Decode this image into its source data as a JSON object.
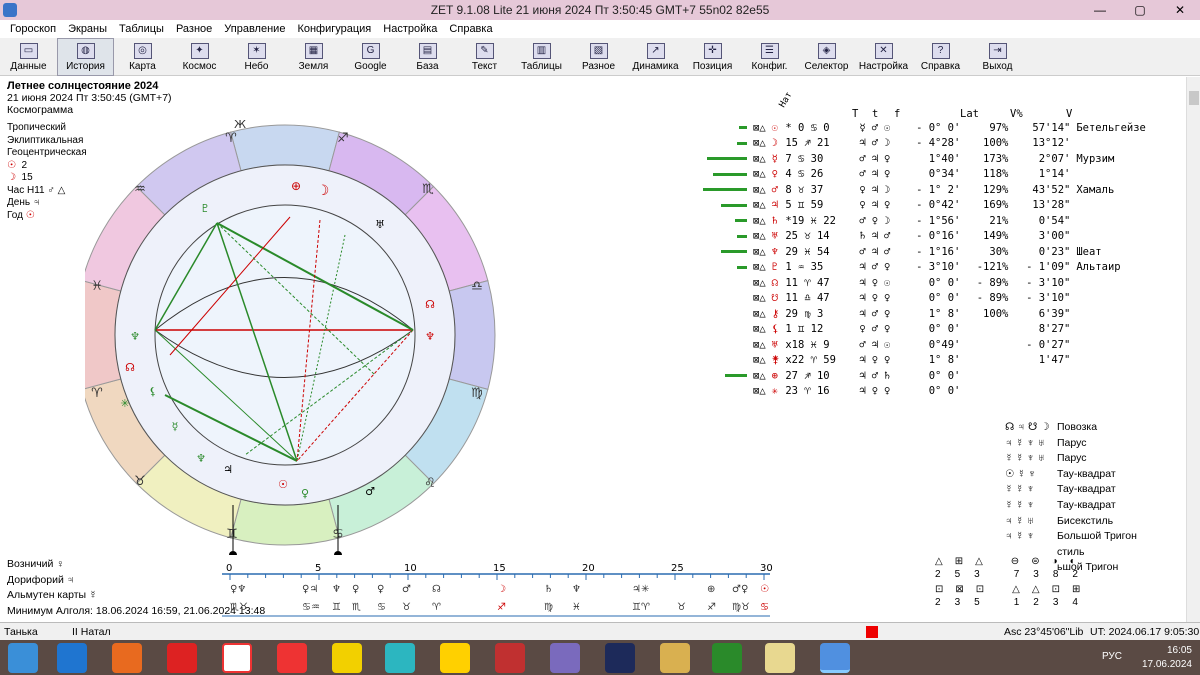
{
  "window": {
    "title": "ZET 9.1.08 Lite    21 июня 2024  Пт    3:50:45 GMT+7 55n02  82e55"
  },
  "menu": [
    "Гороскоп",
    "Экраны",
    "Таблицы",
    "Разное",
    "Управление",
    "Конфигурация",
    "Настройка",
    "Справка"
  ],
  "toolbar": [
    "Данные",
    "История",
    "Карта",
    "Космос",
    "Небо",
    "Земля",
    "Google",
    "База",
    "Текст",
    "Таблицы",
    "Разное",
    "Динамика",
    "Позиция",
    "Конфиг.",
    "Селектор",
    "Настройка",
    "Справка",
    "Выход"
  ],
  "header": {
    "title": "Летнее солнцестояние 2024",
    "date": "21 июня 2024  Пт   3:50:45 (GMT+7)",
    "type": "Космограмма",
    "zodiac": "Тропический",
    "coords": "Эклиптикальная",
    "center": "Геоцентрическая",
    "sun": "2",
    "moon": "15",
    "hour": "Час Н11",
    "day": "День",
    "year": "Год"
  },
  "chart_labels": {
    "natal_col": "Нат",
    "col_T": "T",
    "col_t": "t",
    "col_f": "f",
    "col_lat": "Lat",
    "col_vpct": "V%",
    "col_v": "V"
  },
  "aspect_rows": [
    {
      "sym": "☉",
      "pos": "* 0 ♋ 0",
      "T": "☿",
      "t": "♂",
      "f": "☉",
      "lat": "- 0° 0'",
      "vp": "97%",
      "v": "57'14\"",
      "star": "Бетельгейзе",
      "bar": "#2a9a2a",
      "bw": 8
    },
    {
      "sym": "☽",
      "pos": "15 ♐ 21",
      "T": "♃",
      "t": "♂",
      "f": "☽",
      "lat": "- 4°28'",
      "vp": "100%",
      "v": "13°12'",
      "star": "",
      "bar": "#2a9a2a",
      "bw": 10
    },
    {
      "sym": "☿",
      "pos": "7 ♋ 30",
      "T": "♂",
      "t": "♃",
      "f": "♀",
      "lat": "1°40'",
      "vp": "173%",
      "v": "2°07'",
      "star": "Мурзим",
      "bar": "#2a9a2a",
      "bw": 40
    },
    {
      "sym": "♀",
      "pos": "4 ♋ 26",
      "T": "♂",
      "t": "♃",
      "f": "♀",
      "lat": "0°34'",
      "vp": "118%",
      "v": "1°14'",
      "star": "",
      "bar": "#2a9a2a",
      "bw": 34
    },
    {
      "sym": "♂",
      "pos": "8 ♉ 37",
      "T": "♀",
      "t": "♃",
      "f": "☽",
      "lat": "- 1° 2'",
      "vp": "129%",
      "v": "43'52\"",
      "star": "Хамаль",
      "bar": "#2a9a2a",
      "bw": 44
    },
    {
      "sym": "♃",
      "pos": "5 ♊ 59",
      "T": "♀",
      "t": "♃",
      "f": "♀",
      "lat": "- 0°42'",
      "vp": "169%",
      "v": "13'28\"",
      "star": "",
      "bar": "#2a9a2a",
      "bw": 26
    },
    {
      "sym": "♄",
      "pos": "*19 ♓ 22",
      "T": "♂",
      "t": "♀",
      "f": "☽",
      "lat": "- 1°56'",
      "vp": "21%",
      "v": "0'54\"",
      "star": "",
      "bar": "#2a9a2a",
      "bw": 12
    },
    {
      "sym": "♅",
      "pos": "25 ♉ 14",
      "T": "♄",
      "t": "♃",
      "f": "♂",
      "lat": "- 0°16'",
      "vp": "149%",
      "v": "3'00\"",
      "star": "",
      "bar": "#2a9a2a",
      "bw": 10
    },
    {
      "sym": "♆",
      "pos": "29 ♓ 54",
      "T": "♂",
      "t": "♃",
      "f": "♂",
      "lat": "- 1°16'",
      "vp": "30%",
      "v": "0'23\"",
      "star": "Шеат",
      "bar": "#2a9a2a",
      "bw": 26
    },
    {
      "sym": "♇",
      "pos": "1 ♒ 35",
      "T": "♃",
      "t": "♂",
      "f": "♀",
      "lat": "- 3°10'",
      "vp": "-121%",
      "v": "- 1'09\"",
      "star": "Альтаир",
      "bar": "#2a9a2a",
      "bw": 10
    },
    {
      "sym": "☊",
      "pos": "11 ♈ 47",
      "T": "♃",
      "t": "♀",
      "f": "☉",
      "lat": "0° 0'",
      "vp": "- 89%",
      "v": "- 3'10\"",
      "star": "",
      "bar": "",
      "bw": 0
    },
    {
      "sym": "☋",
      "pos": "11 ♎ 47",
      "T": "♃",
      "t": "♀",
      "f": "♀",
      "lat": "0° 0'",
      "vp": "- 89%",
      "v": "- 3'10\"",
      "star": "",
      "bar": "",
      "bw": 0
    },
    {
      "sym": "⚷",
      "pos": "29 ♍ 3",
      "T": "♃",
      "t": "♂",
      "f": "♀",
      "lat": "1° 8'",
      "vp": "100%",
      "v": "6'39\"",
      "star": "",
      "bar": "",
      "bw": 0
    },
    {
      "sym": "⚸",
      "pos": "1 ♊ 12",
      "T": "♀",
      "t": "♂",
      "f": "♀",
      "lat": "0° 0'",
      "vp": "",
      "v": "8'27\"",
      "star": "",
      "bar": "",
      "bw": 0
    },
    {
      "sym": "♅",
      "pos": "x18 ♓ 9",
      "T": "♂",
      "t": "♃",
      "f": "☉",
      "lat": "0°49'",
      "vp": "",
      "v": "- 0'27\"",
      "star": "",
      "bar": "",
      "bw": 0
    },
    {
      "sym": "⚵",
      "pos": "x22 ♈ 59",
      "T": "♃",
      "t": "♀",
      "f": "♀",
      "lat": "1° 8'",
      "vp": "",
      "v": "1'47\"",
      "star": "",
      "bar": "",
      "bw": 0
    },
    {
      "sym": "⊕",
      "pos": "27 ♐ 10",
      "T": "♃",
      "t": "♂",
      "f": "♄",
      "lat": "0° 0'",
      "vp": "",
      "v": "",
      "star": "",
      "bar": "#2a9a2a",
      "bw": 22
    },
    {
      "sym": "✳",
      "pos": "23 ♈ 16",
      "T": "♃",
      "t": "♀",
      "f": "♀",
      "lat": "0° 0'",
      "vp": "",
      "v": "",
      "star": "",
      "bar": "",
      "bw": 0
    }
  ],
  "patterns": [
    {
      "g": "☊ ♃ ☋ ☽",
      "n": "Повозка"
    },
    {
      "g": "♃ ☿ ♆ ♅",
      "n": "Парус"
    },
    {
      "g": "☿ ☿ ♆ ♅",
      "n": "Парус"
    },
    {
      "g": "☉ ☿ ♆",
      "n": "Тау-квадрат"
    },
    {
      "g": "☿ ☿ ♆",
      "n": "Тау-квадрат"
    },
    {
      "g": "☿ ☿ ♆",
      "n": "Тау-квадрат"
    },
    {
      "g": "♃ ☿ ♅",
      "n": "Бисекстиль"
    },
    {
      "g": "♃ ☿ ♆",
      "n": "Большой Тригон"
    },
    {
      "g": "",
      "n": "стиль"
    },
    {
      "g": "",
      "n": "ьшой Тригон"
    }
  ],
  "bottom": {
    "l1": "Возничий  ♀",
    "l2": "Дорифорий  ♃",
    "l3": "Альмутен карты  ☿",
    "l4": "Минимум Алголя: 18.06.2024 16:59,  21.06.2024 13:48",
    "scale": [
      "0",
      "5",
      "10",
      "15",
      "20",
      "25",
      "30"
    ]
  },
  "groups": {
    "row1": [
      "2",
      "5",
      "3",
      "7",
      "3",
      "8",
      "2"
    ],
    "row2": [
      "2",
      "3",
      "5",
      "1",
      "2",
      "3",
      "4"
    ]
  },
  "status": {
    "user": "Танька",
    "natal": "II Натал",
    "asc": "Asc  23°45'06\"Lib",
    "ut": "UT: 2024.06.17  9:05:30"
  },
  "tray": {
    "lang": "РУС",
    "time": "16:05",
    "date": "17.06.2024"
  }
}
